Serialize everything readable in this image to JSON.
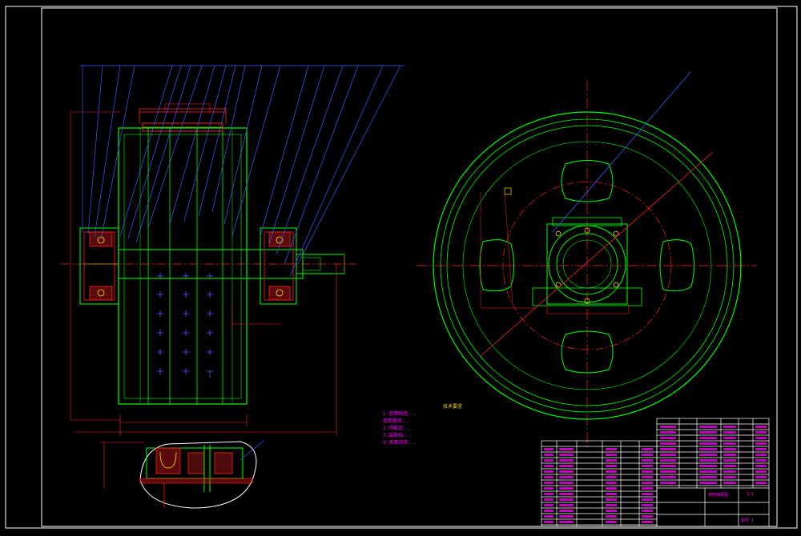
{
  "drawing": {
    "colors": {
      "background": "#000000",
      "frame": "#ffffff",
      "outline": "#00ff00",
      "centerline": "#ff2020",
      "leader": "#3a5bff",
      "text": "#ff00ff",
      "accent": "#ffd800"
    },
    "technical_requirements": {
      "title": "技术要求",
      "lines": [
        "1.卷筒制造...",
        "卷筒壁厚...",
        "2.焊接后...",
        "3.装配后...",
        "4.表面涂漆..."
      ]
    },
    "title_block": {
      "drawing_name": "卷筒装配图",
      "scale": "1:1",
      "sheet": "图号 1"
    }
  }
}
